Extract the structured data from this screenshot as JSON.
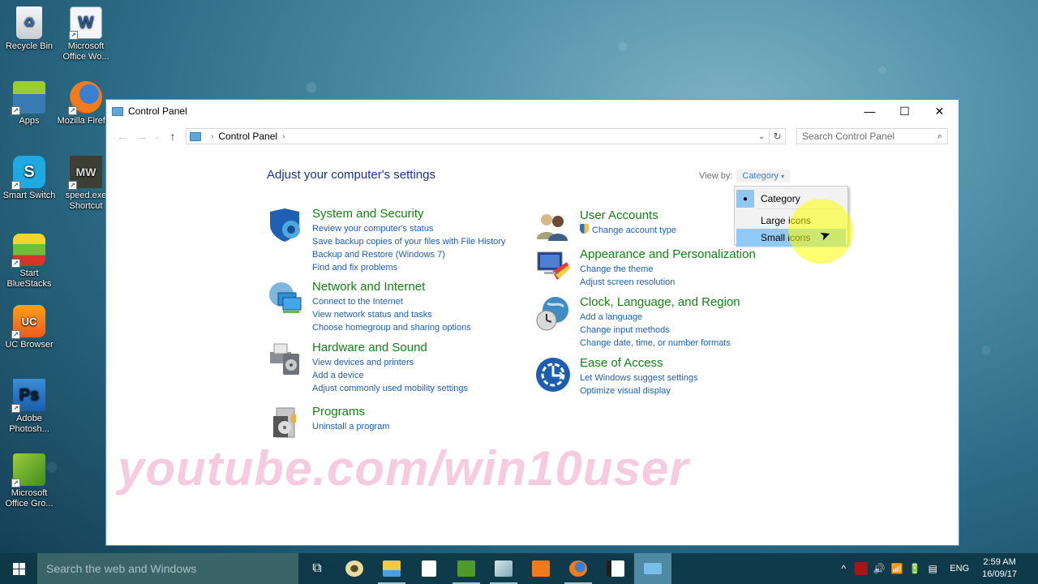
{
  "desktop": {
    "icons": [
      {
        "label": "Recycle Bin",
        "icon": "recycle-bin-icon"
      },
      {
        "label": "Microsoft Office Wo...",
        "icon": "word-icon"
      },
      {
        "label": "Apps",
        "icon": "apps-icon"
      },
      {
        "label": "Mozilla Firefox",
        "icon": "firefox-icon"
      },
      {
        "label": "Smart Switch",
        "icon": "smart-switch-icon"
      },
      {
        "label": "speed.exe Shortcut",
        "icon": "nfs-icon"
      },
      {
        "label": "Start BlueStacks",
        "icon": "bluestacks-icon"
      },
      {
        "label": "UC Browser",
        "icon": "uc-browser-icon"
      },
      {
        "label": "Adobe Photosh...",
        "icon": "photoshop-icon"
      },
      {
        "label": "Microsoft Office Gro...",
        "icon": "office-groove-icon"
      }
    ],
    "glyphs": {
      "word": "W",
      "smart": "S",
      "nfs": "MW",
      "ps": "Ps",
      "uc": "UC"
    }
  },
  "window": {
    "title": "Control Panel",
    "controls": {
      "minimize": "—",
      "maximize": "☐",
      "close": "✕"
    },
    "nav": {
      "back": "←",
      "forward": "→",
      "recent": "⌄",
      "up": "↑"
    },
    "address": {
      "crumbs": [
        "Control Panel"
      ],
      "separator": "›",
      "dropdown": "⌄",
      "refresh": "↻"
    },
    "search": {
      "placeholder": "Search Control Panel",
      "value": "",
      "icon": "⌕"
    },
    "heading": "Adjust your computer's settings",
    "view_by": {
      "label": "View by:",
      "selected": "Category",
      "caret": "▾",
      "options": [
        {
          "label": "Category",
          "checked": true
        },
        {
          "label": "Large icons",
          "checked": false
        },
        {
          "label": "Small icons",
          "checked": false,
          "hovered": true
        }
      ],
      "bullet": "●"
    },
    "categories_left": [
      {
        "title": "System and Security",
        "icon": "system-security-icon",
        "links": [
          "Review your computer's status",
          "Save backup copies of your files with File History",
          "Backup and Restore (Windows 7)",
          "Find and fix problems"
        ]
      },
      {
        "title": "Network and Internet",
        "icon": "network-internet-icon",
        "links": [
          "Connect to the Internet",
          "View network status and tasks",
          "Choose homegroup and sharing options"
        ]
      },
      {
        "title": "Hardware and Sound",
        "icon": "hardware-sound-icon",
        "links": [
          "View devices and printers",
          "Add a device",
          "Adjust commonly used mobility settings"
        ]
      },
      {
        "title": "Programs",
        "icon": "programs-icon",
        "links": [
          "Uninstall a program"
        ]
      }
    ],
    "categories_right": [
      {
        "title": "User Accounts",
        "icon": "user-accounts-icon",
        "links": [
          "Change account type"
        ]
      },
      {
        "title": "Appearance and Personalization",
        "icon": "appearance-icon",
        "links": [
          "Change the theme",
          "Adjust screen resolution"
        ]
      },
      {
        "title": "Clock, Language, and Region",
        "icon": "clock-region-icon",
        "links": [
          "Add a language",
          "Change input methods",
          "Change date, time, or number formats"
        ]
      },
      {
        "title": "Ease of Access",
        "icon": "ease-of-access-icon",
        "links": [
          "Let Windows suggest settings",
          "Optimize visual display"
        ]
      }
    ],
    "watermark": "youtube.com/win10user"
  },
  "taskbar": {
    "search_placeholder": "Search the web and Windows",
    "task_view": "⧉",
    "pinned": [
      "audio-app",
      "file-explorer",
      "store",
      "camtasia",
      "notepad-app",
      "uc-browser",
      "firefox",
      "camtasia-recorder",
      "control-panel"
    ],
    "tray": {
      "chevron": "^",
      "volume": "🔊",
      "wifi": "📶",
      "battery": "🔋",
      "action": "▤",
      "language": "ENG"
    },
    "time": "2:59 AM",
    "date": "16/09/17"
  },
  "colors": {
    "category_title": "#168016",
    "link": "#1e5fb4",
    "heading": "#1e3287",
    "highlight": "#91c9f7"
  }
}
